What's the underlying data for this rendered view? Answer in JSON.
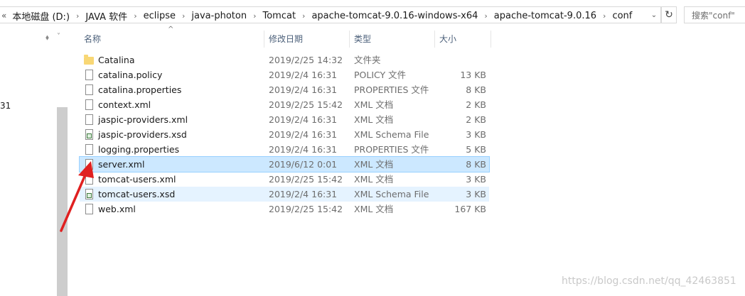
{
  "address_bar": {
    "lead": "«",
    "crumbs": [
      "本地磁盘 (D:)",
      "JAVA 软件",
      "eclipse",
      "java-photon",
      "Tomcat",
      "apache-tomcat-9.0.16-windows-x64",
      "apache-tomcat-9.0.16",
      "conf"
    ],
    "separator": "›",
    "dropdown_icon": "chevron-down-icon",
    "refresh_icon": "refresh-icon",
    "refresh_glyph": "↻"
  },
  "search": {
    "placeholder": "搜索\"conf\""
  },
  "nav_pane": {
    "fragment_text": "31",
    "pin_icon": "pin-icon",
    "pin_glyph": "📌",
    "collapse_glyph": "˅"
  },
  "columns": {
    "name": "名称",
    "modified": "修改日期",
    "type": "类型",
    "size": "大小",
    "sort_glyph": "^"
  },
  "files": [
    {
      "name": "Catalina",
      "modified": "2019/2/25 14:32",
      "type": "文件夹",
      "size": "",
      "icon": "folder-icon",
      "state": ""
    },
    {
      "name": "catalina.policy",
      "modified": "2019/2/4 16:31",
      "type": "POLICY 文件",
      "size": "13 KB",
      "icon": "file-icon",
      "state": ""
    },
    {
      "name": "catalina.properties",
      "modified": "2019/2/4 16:31",
      "type": "PROPERTIES 文件",
      "size": "8 KB",
      "icon": "file-icon",
      "state": ""
    },
    {
      "name": "context.xml",
      "modified": "2019/2/25 15:42",
      "type": "XML 文档",
      "size": "2 KB",
      "icon": "file-icon",
      "state": ""
    },
    {
      "name": "jaspic-providers.xml",
      "modified": "2019/2/4 16:31",
      "type": "XML 文档",
      "size": "2 KB",
      "icon": "file-icon",
      "state": ""
    },
    {
      "name": "jaspic-providers.xsd",
      "modified": "2019/2/4 16:31",
      "type": "XML Schema File",
      "size": "3 KB",
      "icon": "xsd-file-icon",
      "state": ""
    },
    {
      "name": "logging.properties",
      "modified": "2019/2/4 16:31",
      "type": "PROPERTIES 文件",
      "size": "5 KB",
      "icon": "file-icon",
      "state": ""
    },
    {
      "name": "server.xml",
      "modified": "2019/6/12 0:01",
      "type": "XML 文档",
      "size": "8 KB",
      "icon": "file-icon",
      "state": "selected"
    },
    {
      "name": "tomcat-users.xml",
      "modified": "2019/2/25 15:42",
      "type": "XML 文档",
      "size": "3 KB",
      "icon": "file-icon",
      "state": ""
    },
    {
      "name": "tomcat-users.xsd",
      "modified": "2019/2/4 16:31",
      "type": "XML Schema File",
      "size": "3 KB",
      "icon": "xsd-file-icon",
      "state": "hover"
    },
    {
      "name": "web.xml",
      "modified": "2019/2/25 15:42",
      "type": "XML 文档",
      "size": "167 KB",
      "icon": "file-icon",
      "state": ""
    }
  ],
  "annotation": {
    "arrow_color": "#e02020"
  },
  "watermark": "https://blog.csdn.net/qq_42463851",
  "colors": {
    "selected_bg": "#cce8ff",
    "hover_bg": "#e5f3ff",
    "header_text": "#4c607a"
  }
}
